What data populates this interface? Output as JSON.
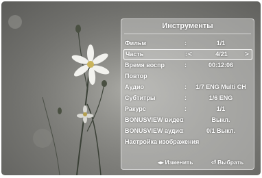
{
  "menu": {
    "title": "Инструменты",
    "rows": [
      {
        "label": "Фильм",
        "colon": ":",
        "value": "1/1"
      },
      {
        "label": "Часть",
        "colon": ":",
        "value": "4/21",
        "left_arrow": "<",
        "right_arrow": ">"
      },
      {
        "label": "Время воспр",
        "colon": ":",
        "value": "00:12:06"
      },
      {
        "label": "Повтор",
        "colon": "",
        "value": ""
      },
      {
        "label": "Аудио",
        "colon": ":",
        "value": "1/7 ENG Multi CH"
      },
      {
        "label": "Субтитры",
        "colon": ":",
        "value": "1/6 ENG"
      },
      {
        "label": "Ракурс",
        "colon": ":",
        "value": "1/1"
      },
      {
        "label": "BONUSVIEW видео",
        "colon": ":",
        "value": "Выкл."
      },
      {
        "label": "BONUSVIEW аудио",
        "colon": ":",
        "value": "0/1 Выкл."
      },
      {
        "label": "Настройка изображения",
        "colon": "",
        "value": ""
      }
    ]
  },
  "footer": {
    "change_icon": "◂▸",
    "change_label": "Изменить",
    "select_icon": "⏎",
    "select_label": "Выбрать"
  }
}
